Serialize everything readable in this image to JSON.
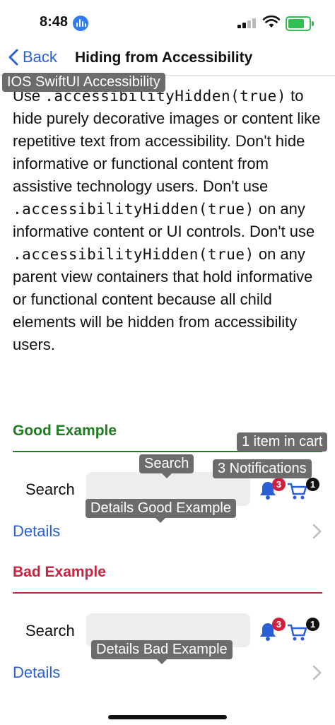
{
  "status_bar": {
    "time": "8:48"
  },
  "nav": {
    "back_label": "Back",
    "title": "Hiding from Accessibility"
  },
  "tooltips": {
    "app": "IOS SwiftUI Accessibility",
    "search": "Search",
    "cart": "1 item in cart",
    "notifications": "3 Notifications",
    "details_good": "Details Good Example",
    "details_bad": "Details Bad Example"
  },
  "content": {
    "p1": "Use ",
    "p2": ".accessibilityHidden(true)",
    "p3": " to hide purely decorative images or content like repetitive text from accessibility. Don't hide informative or functional content from assistive technology users. Don't use ",
    "p4": ".accessibilityHidden(true)",
    "p5": " on any informative content or UI controls. Don't use ",
    "p6": ".accessibilityHidden(true)",
    "p7": " on any parent view containers that hold informative or functional content because all child elements will be hidden from accessibility users."
  },
  "good": {
    "title": "Good Example",
    "search_label": "Search",
    "details_label": "Details",
    "bell_badge": "3",
    "cart_badge": "1"
  },
  "bad": {
    "title": "Bad Example",
    "search_label": "Search",
    "details_label": "Details",
    "bell_badge": "3",
    "cart_badge": "1"
  },
  "colors": {
    "accent": "#2a5fd8",
    "good": "#1e7d1e",
    "bad": "#c8233f",
    "badge_red": "#d21f3c",
    "tooltip": "#6c6c6c"
  }
}
